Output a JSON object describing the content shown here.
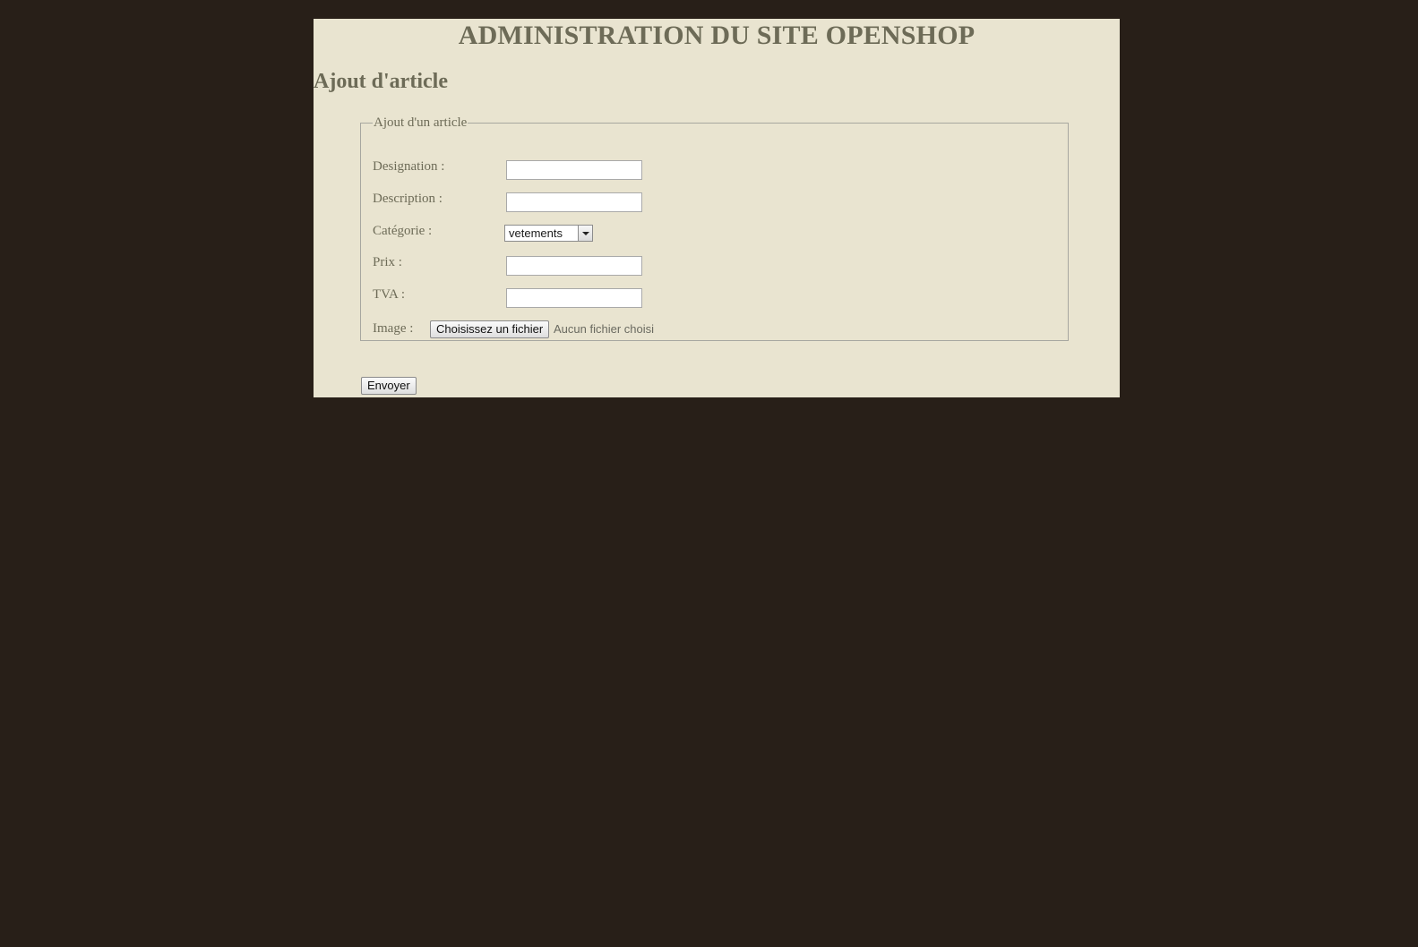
{
  "header": {
    "site_title": "ADMINISTRATION DU SITE OPENSHOP"
  },
  "main": {
    "section_title": "Ajout d'article",
    "form": {
      "legend": "Ajout d'un article",
      "fields": {
        "designation": {
          "label": "Designation :",
          "value": ""
        },
        "description": {
          "label": "Description :",
          "value": ""
        },
        "categorie": {
          "label": "Catégorie :",
          "selected": "vetements"
        },
        "prix": {
          "label": "Prix :",
          "value": ""
        },
        "tva": {
          "label": "TVA :",
          "value": ""
        },
        "image": {
          "label": "Image :",
          "button_label": "Choisissez un fichier",
          "status": "Aucun fichier choisi"
        }
      },
      "submit_label": "Envoyer"
    }
  },
  "colors": {
    "page_background": "#281f18",
    "panel_background": "#e9e4d0",
    "text": "#6d6b57"
  }
}
